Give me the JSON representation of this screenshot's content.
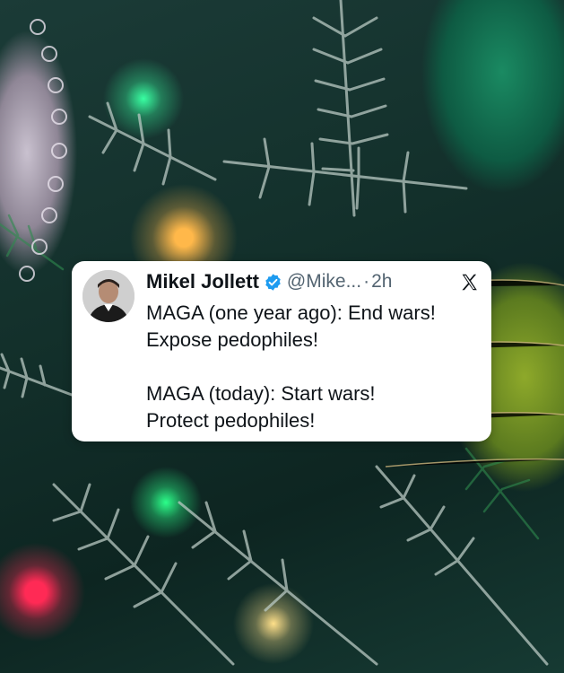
{
  "background": {
    "description_icon": "christmas-tree-icon"
  },
  "tweet": {
    "author_name": "Mikel Jollett",
    "handle": "@Mike...",
    "separator": "·",
    "time": "2h",
    "verified_icon": "verified-badge-icon",
    "platform_icon": "x-logo-icon",
    "lines": [
      "MAGA (one year ago): End wars!",
      "Expose pedophiles!",
      "",
      "MAGA (today): Start wars!",
      "Protect pedophiles!"
    ]
  },
  "colors": {
    "verified": "#1d9bf0",
    "text": "#0f1419",
    "secondary": "#536471",
    "card": "#ffffff"
  }
}
